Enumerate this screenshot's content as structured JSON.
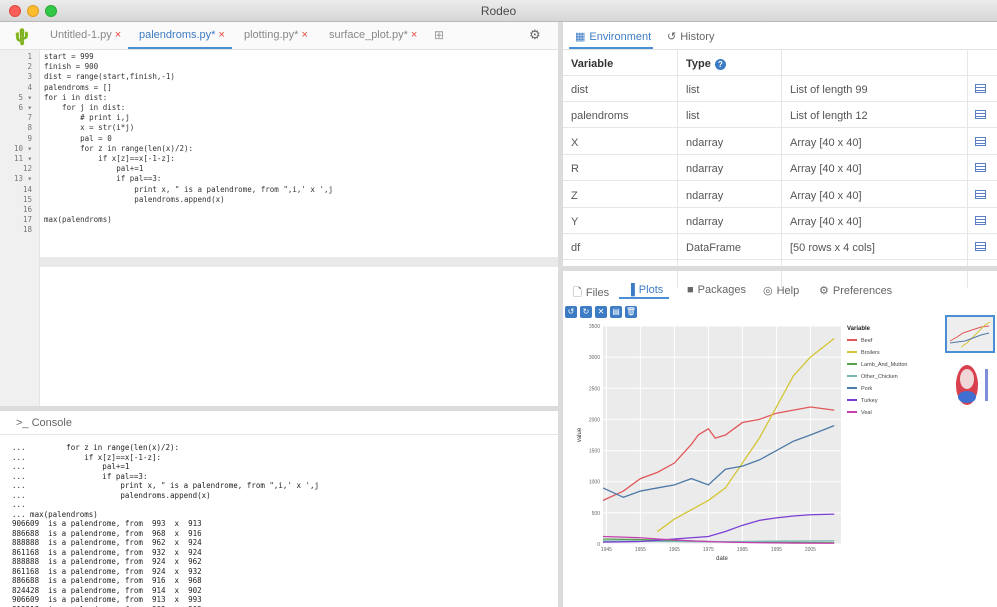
{
  "window": {
    "title": "Rodeo"
  },
  "editor_tabs": [
    {
      "label": "Untitled-1.py",
      "close": "×"
    },
    {
      "label": "palendroms.py*",
      "close": "×"
    },
    {
      "label": "plotting.py*",
      "close": "×"
    },
    {
      "label": "surface_plot.py*",
      "close": "×"
    }
  ],
  "editor": {
    "line_numbers": [
      "1",
      "2",
      "3",
      "4",
      "5 ▾",
      "6 ▾",
      "7",
      "8",
      "9",
      "10 ▾",
      "11 ▾",
      "12",
      "13 ▾",
      "14",
      "15",
      "16",
      "17",
      "18"
    ],
    "lines": [
      "start = 999",
      "finish = 900",
      "dist = range(start,finish,-1)",
      "palendroms = []",
      "for i in dist:",
      "    for j in dist:",
      "        # print i,j",
      "        x = str(i*j)",
      "        pal = 0",
      "        for z in range(len(x)/2):",
      "            if x[z]==x[-1-z]:",
      "                pal+=1",
      "                if pal==3:",
      "                    print x, \" is a palendrome, from \",i,' x ',j",
      "                    palendroms.append(x)",
      "",
      "max(palendroms)",
      ""
    ]
  },
  "console": {
    "title": ">_ Console",
    "lines": [
      "...         for z in range(len(x)/2):",
      "...             if x[z]==x[-1-z]:",
      "...                 pal+=1",
      "...                 if pal==3:",
      "...                     print x, \" is a palendrome, from \",i,' x ',j",
      "...                     palendroms.append(x)",
      "...",
      "... max(palendroms)",
      "906609  is a palendrome, from  993  x  913",
      "886688  is a palendrome, from  968  x  916",
      "888888  is a palendrome, from  962  x  924",
      "861168  is a palendrome, from  932  x  924",
      "888888  is a palendrome, from  924  x  962",
      "861168  is a palendrome, from  924  x  932",
      "886688  is a palendrome, from  916  x  968",
      "824428  is a palendrome, from  914  x  902",
      "906609  is a palendrome, from  913  x  993",
      "819918  is a palendrome, from  909  x  902"
    ]
  },
  "env_tabs": {
    "environment": "Environment",
    "history": "History"
  },
  "env_table": {
    "headers": {
      "variable": "Variable",
      "type": "Type"
    },
    "rows": [
      {
        "variable": "dist",
        "type": "list",
        "value": "List of length 99"
      },
      {
        "variable": "palendroms",
        "type": "list",
        "value": "List of length 12"
      },
      {
        "variable": "X",
        "type": "ndarray",
        "value": "Array [40 x 40]"
      },
      {
        "variable": "R",
        "type": "ndarray",
        "value": "Array [40 x 40]"
      },
      {
        "variable": "Z",
        "type": "ndarray",
        "value": "Array [40 x 40]"
      },
      {
        "variable": "Y",
        "type": "ndarray",
        "value": "Array [40 x 40]"
      },
      {
        "variable": "df",
        "type": "DataFrame",
        "value": "[50 rows x 4 cols]"
      }
    ]
  },
  "plot_tabs": {
    "files": "Files",
    "plots": "Plots",
    "packages": "Packages",
    "help": "Help",
    "preferences": "Preferences"
  },
  "plot_toolbar": [
    "↺",
    "↻",
    "✕",
    "▤",
    "🗑"
  ],
  "chart_data": {
    "type": "line",
    "xlabel": "date",
    "ylabel": "value",
    "x_ticks": [
      "1945",
      "1955",
      "1965",
      "1975",
      "1985",
      "1995",
      "2005"
    ],
    "y_ticks": [
      "0",
      "500",
      "1000",
      "1500",
      "2000",
      "2500",
      "3000",
      "3500"
    ],
    "ylim": [
      0,
      3500
    ],
    "legend_title": "Variable",
    "series": [
      {
        "name": "Beef",
        "color": "#e15759",
        "x": [
          1944,
          1950,
          1955,
          1960,
          1965,
          1970,
          1972,
          1975,
          1977,
          1980,
          1985,
          1990,
          1995,
          2000,
          2005,
          2012
        ],
        "values": [
          700,
          850,
          1050,
          1150,
          1300,
          1600,
          1750,
          1850,
          1700,
          1750,
          1950,
          2000,
          2100,
          2150,
          2200,
          2150
        ]
      },
      {
        "name": "Broilers",
        "color": "#d4c535",
        "x": [
          1960,
          1965,
          1970,
          1975,
          1980,
          1985,
          1990,
          1995,
          2000,
          2005,
          2012
        ],
        "values": [
          200,
          400,
          550,
          700,
          900,
          1300,
          1700,
          2200,
          2700,
          3000,
          3300
        ]
      },
      {
        "name": "Lamb_And_Mutton",
        "color": "#59a14f",
        "x": [
          1944,
          1955,
          1965,
          1975,
          1985,
          1995,
          2012
        ],
        "values": [
          80,
          70,
          55,
          40,
          30,
          25,
          20
        ]
      },
      {
        "name": "Other_Chicken",
        "color": "#76b7b2",
        "x": [
          1944,
          1955,
          1965,
          1975,
          1985,
          1995,
          2012
        ],
        "values": [
          50,
          45,
          40,
          35,
          40,
          45,
          50
        ]
      },
      {
        "name": "Pork",
        "color": "#4e79a7",
        "x": [
          1944,
          1950,
          1955,
          1960,
          1965,
          1970,
          1975,
          1980,
          1985,
          1990,
          1995,
          2000,
          2005,
          2012
        ],
        "values": [
          900,
          750,
          850,
          900,
          950,
          1050,
          950,
          1200,
          1250,
          1350,
          1500,
          1650,
          1750,
          1900
        ]
      },
      {
        "name": "Turkey",
        "color": "#7b3fd4",
        "x": [
          1944,
          1955,
          1965,
          1975,
          1980,
          1985,
          1990,
          1995,
          2000,
          2005,
          2012
        ],
        "values": [
          30,
          40,
          80,
          120,
          200,
          300,
          380,
          420,
          450,
          470,
          480
        ]
      },
      {
        "name": "Veal",
        "color": "#c53fb0",
        "x": [
          1944,
          1950,
          1955,
          1960,
          1970,
          1980,
          1990,
          2000,
          2012
        ],
        "values": [
          120,
          110,
          100,
          80,
          50,
          30,
          20,
          15,
          12
        ]
      }
    ]
  }
}
